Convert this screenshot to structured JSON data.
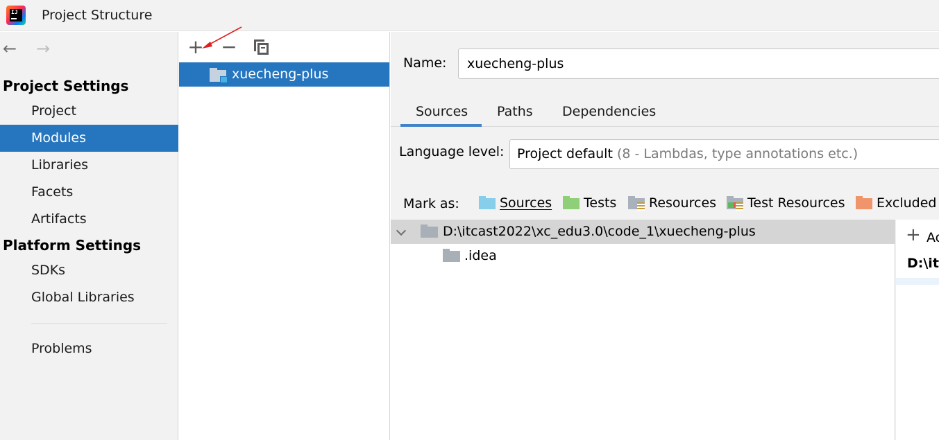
{
  "window": {
    "title": "Project Structure"
  },
  "sidebar": {
    "sections": [
      {
        "header": "Project Settings",
        "items": [
          "Project",
          "Modules",
          "Libraries",
          "Facets",
          "Artifacts"
        ]
      },
      {
        "header": "Platform Settings",
        "items": [
          "SDKs",
          "Global Libraries"
        ]
      }
    ],
    "bottom_items": [
      "Problems"
    ],
    "selected": "Modules"
  },
  "modules": {
    "list": [
      "xuecheng-plus"
    ],
    "selected": "xuecheng-plus"
  },
  "detail": {
    "name_label": "Name:",
    "name_value": "xuecheng-plus",
    "tabs": [
      "Sources",
      "Paths",
      "Dependencies"
    ],
    "active_tab": "Sources",
    "language_level_label": "Language level:",
    "language_level_value": "Project default",
    "language_level_hint": "(8 - Lambdas, type annotations etc.)",
    "mark_as_label": "Mark as:",
    "mark_as": [
      "Sources",
      "Tests",
      "Resources",
      "Test Resources",
      "Excluded"
    ],
    "tree": {
      "root": "D:\\itcast2022\\xc_edu3.0\\code_1\\xuecheng-plus",
      "children": [
        ".idea"
      ]
    },
    "content_roots": {
      "add_label": "Ac",
      "root_path": "D:\\itc"
    }
  },
  "colors": {
    "accent": "#2675bf",
    "sidebar_bg": "#f2f2f2",
    "arrow": "#e02020"
  }
}
